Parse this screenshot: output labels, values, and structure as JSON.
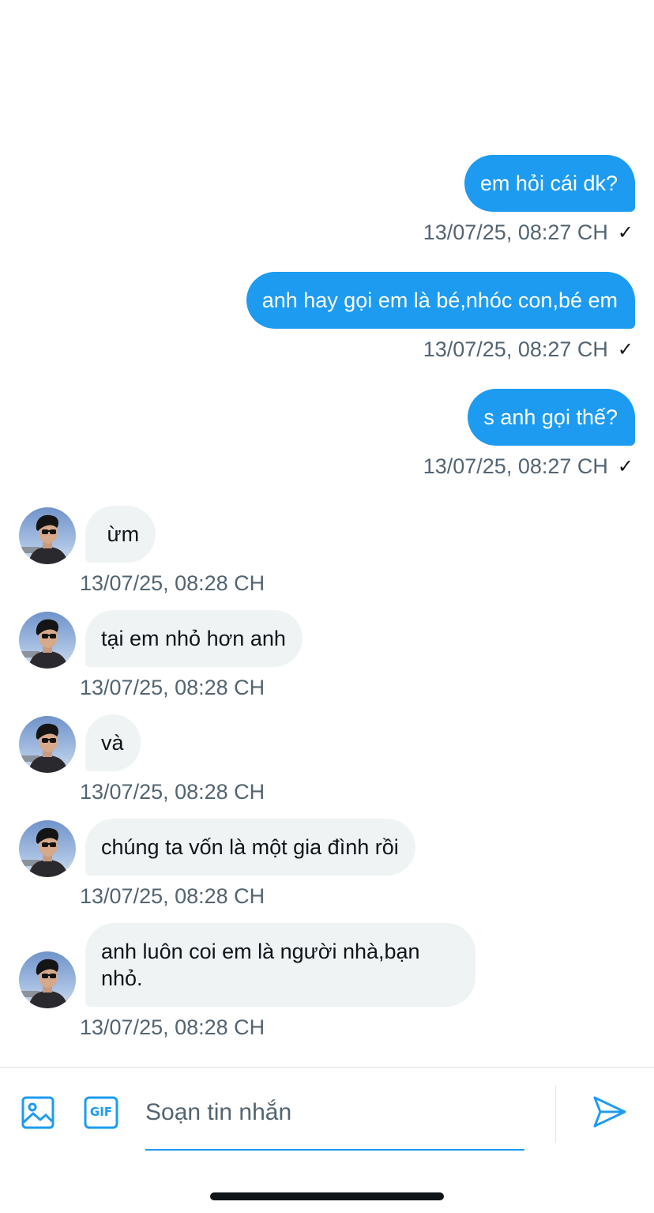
{
  "outgoing": [
    {
      "text": "em hỏi cái dk?",
      "time": "13/07/25, 08:27 CH",
      "check": "✓"
    },
    {
      "text": "anh hay gọi em là bé,nhóc con,bé em",
      "time": "13/07/25, 08:27 CH",
      "check": "✓"
    },
    {
      "text": "s anh gọi thế?",
      "time": "13/07/25, 08:27 CH",
      "check": "✓"
    }
  ],
  "incoming": [
    {
      "text": " ừm",
      "time": "13/07/25, 08:28 CH"
    },
    {
      "text": "tại em nhỏ hơn anh",
      "time": "13/07/25, 08:28 CH"
    },
    {
      "text": "và",
      "time": "13/07/25, 08:28 CH"
    },
    {
      "text": "chúng ta vốn là một gia đình rồi",
      "time": "13/07/25, 08:28 CH"
    },
    {
      "text": "anh luôn coi em là người nhà,bạn nhỏ.",
      "time": "13/07/25, 08:28 CH"
    }
  ],
  "composer": {
    "placeholder": "Soạn tin nhắn",
    "icons": [
      "image-icon",
      "gif-icon",
      "send-icon"
    ],
    "gif_label": "GIF"
  },
  "colors": {
    "accent": "#1d9bf0",
    "incoming_bubble": "#eff3f4",
    "timestamp": "#536471"
  }
}
